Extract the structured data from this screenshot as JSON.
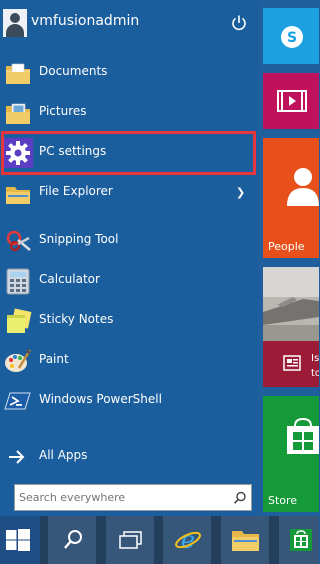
{
  "user": {
    "name": "vmfusionadmin",
    "avatar_icon": "user-avatar-icon",
    "power_icon": "power-icon"
  },
  "menu": [
    {
      "label": "Documents",
      "icon": "folder-icon"
    },
    {
      "label": "Pictures",
      "icon": "folder-icon"
    },
    {
      "label": "PC settings",
      "icon": "gear-icon"
    },
    {
      "label": "File Explorer",
      "icon": "folder-icon",
      "has_submenu": true
    },
    {
      "label": "Snipping Tool",
      "icon": "scissors-icon"
    },
    {
      "label": "Calculator",
      "icon": "calculator-icon"
    },
    {
      "label": "Sticky Notes",
      "icon": "sticky-notes-icon"
    },
    {
      "label": "Paint",
      "icon": "paint-icon"
    },
    {
      "label": "Windows PowerShell",
      "icon": "powershell-icon"
    }
  ],
  "all_apps": {
    "label": "All Apps",
    "icon": "arrow-right-icon"
  },
  "search": {
    "placeholder": "Search everywhere",
    "icon": "search-icon"
  },
  "tiles": [
    {
      "name": "Skype",
      "color": "#1ba1e2",
      "icon": "skype-icon"
    },
    {
      "name": "Video",
      "color": "#c0125c",
      "icon": "video-icon"
    },
    {
      "name": "People",
      "color": "#e8501b",
      "icon": "people-icon",
      "label": "People"
    },
    {
      "name": "News",
      "color": "#9c1c38",
      "icon": "news-icon",
      "label": "Is",
      "label2": "to"
    },
    {
      "name": "Store",
      "color": "#159a39",
      "icon": "store-icon",
      "label": "Store"
    }
  ],
  "colors": {
    "highlight": "#e8363f",
    "menu_bg": "#1b5e9d",
    "taskbar_bg": "#243f5c"
  },
  "taskbar": [
    "start-button",
    "search-button",
    "task-view-button",
    "internet-explorer-button",
    "file-explorer-button",
    "store-button"
  ]
}
